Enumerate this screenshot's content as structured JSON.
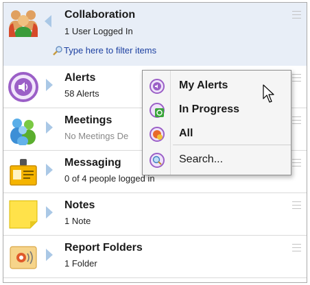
{
  "header": {
    "title": "Collaboration",
    "subtitle": "1 User Logged In",
    "filter_placeholder": "Type here to filter items"
  },
  "items": [
    {
      "title": "Alerts",
      "subtitle": "58 Alerts",
      "icon": "alert-speaker-icon"
    },
    {
      "title": "Meetings",
      "subtitle": "No Meetings De",
      "icon": "people-icon"
    },
    {
      "title": "Messaging",
      "subtitle": "0 of 4 people logged in",
      "icon": "id-badge-icon"
    },
    {
      "title": "Notes",
      "subtitle": "1 Note",
      "icon": "sticky-note-icon"
    },
    {
      "title": "Report Folders",
      "subtitle": "1 Folder",
      "icon": "report-folder-icon"
    }
  ],
  "menu": {
    "items": [
      {
        "label": "My Alerts",
        "icon": "my-alerts-icon"
      },
      {
        "label": "In Progress",
        "icon": "in-progress-icon"
      },
      {
        "label": "All",
        "icon": "all-alerts-icon"
      },
      {
        "label": "Search...",
        "icon": "search-icon"
      }
    ]
  },
  "colors": {
    "header_bg": "#e8eef7",
    "link": "#1b3fa0",
    "chevron": "#aac8e6",
    "alert_purple": "#9b5fc7"
  }
}
